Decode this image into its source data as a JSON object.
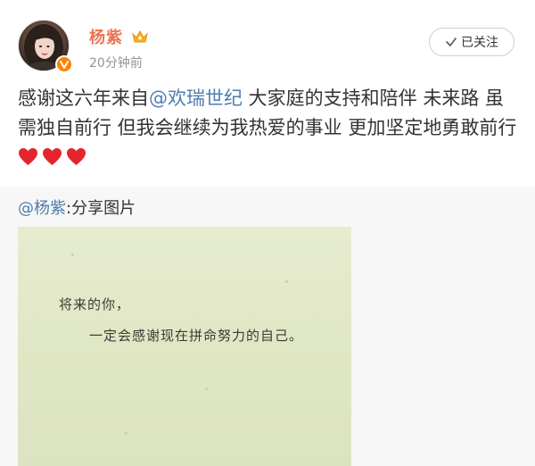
{
  "post": {
    "author": {
      "name": "杨紫",
      "avatar_icon": "avatar-photo",
      "verified_icon": "verified-v-badge",
      "member_icon": "crown-icon"
    },
    "time": "20分钟前",
    "follow_button": {
      "label": "已关注",
      "icon": "check-icon"
    },
    "text": {
      "part1": "感谢这六年来自",
      "mention": "@欢瑞世纪",
      "part2": " 大家庭的支持和陪伴 未来路 虽需独自前行 但我会继续为我热爱的事业 更加坚定地勇敢前行",
      "emojis": [
        "heart",
        "heart",
        "heart"
      ]
    },
    "shared": {
      "mention": "@杨紫",
      "suffix": ":分享图片",
      "image_text": {
        "line1": "将来的你，",
        "line2": "一定会感谢现在拼命努力的自己。"
      }
    }
  },
  "colors": {
    "username": "#eb7350",
    "mention": "#507daf",
    "heart": "#e5252c",
    "verified": "#ff8200",
    "share_bg": "#f7f7f7",
    "image_bg": "#e2e9c9"
  }
}
